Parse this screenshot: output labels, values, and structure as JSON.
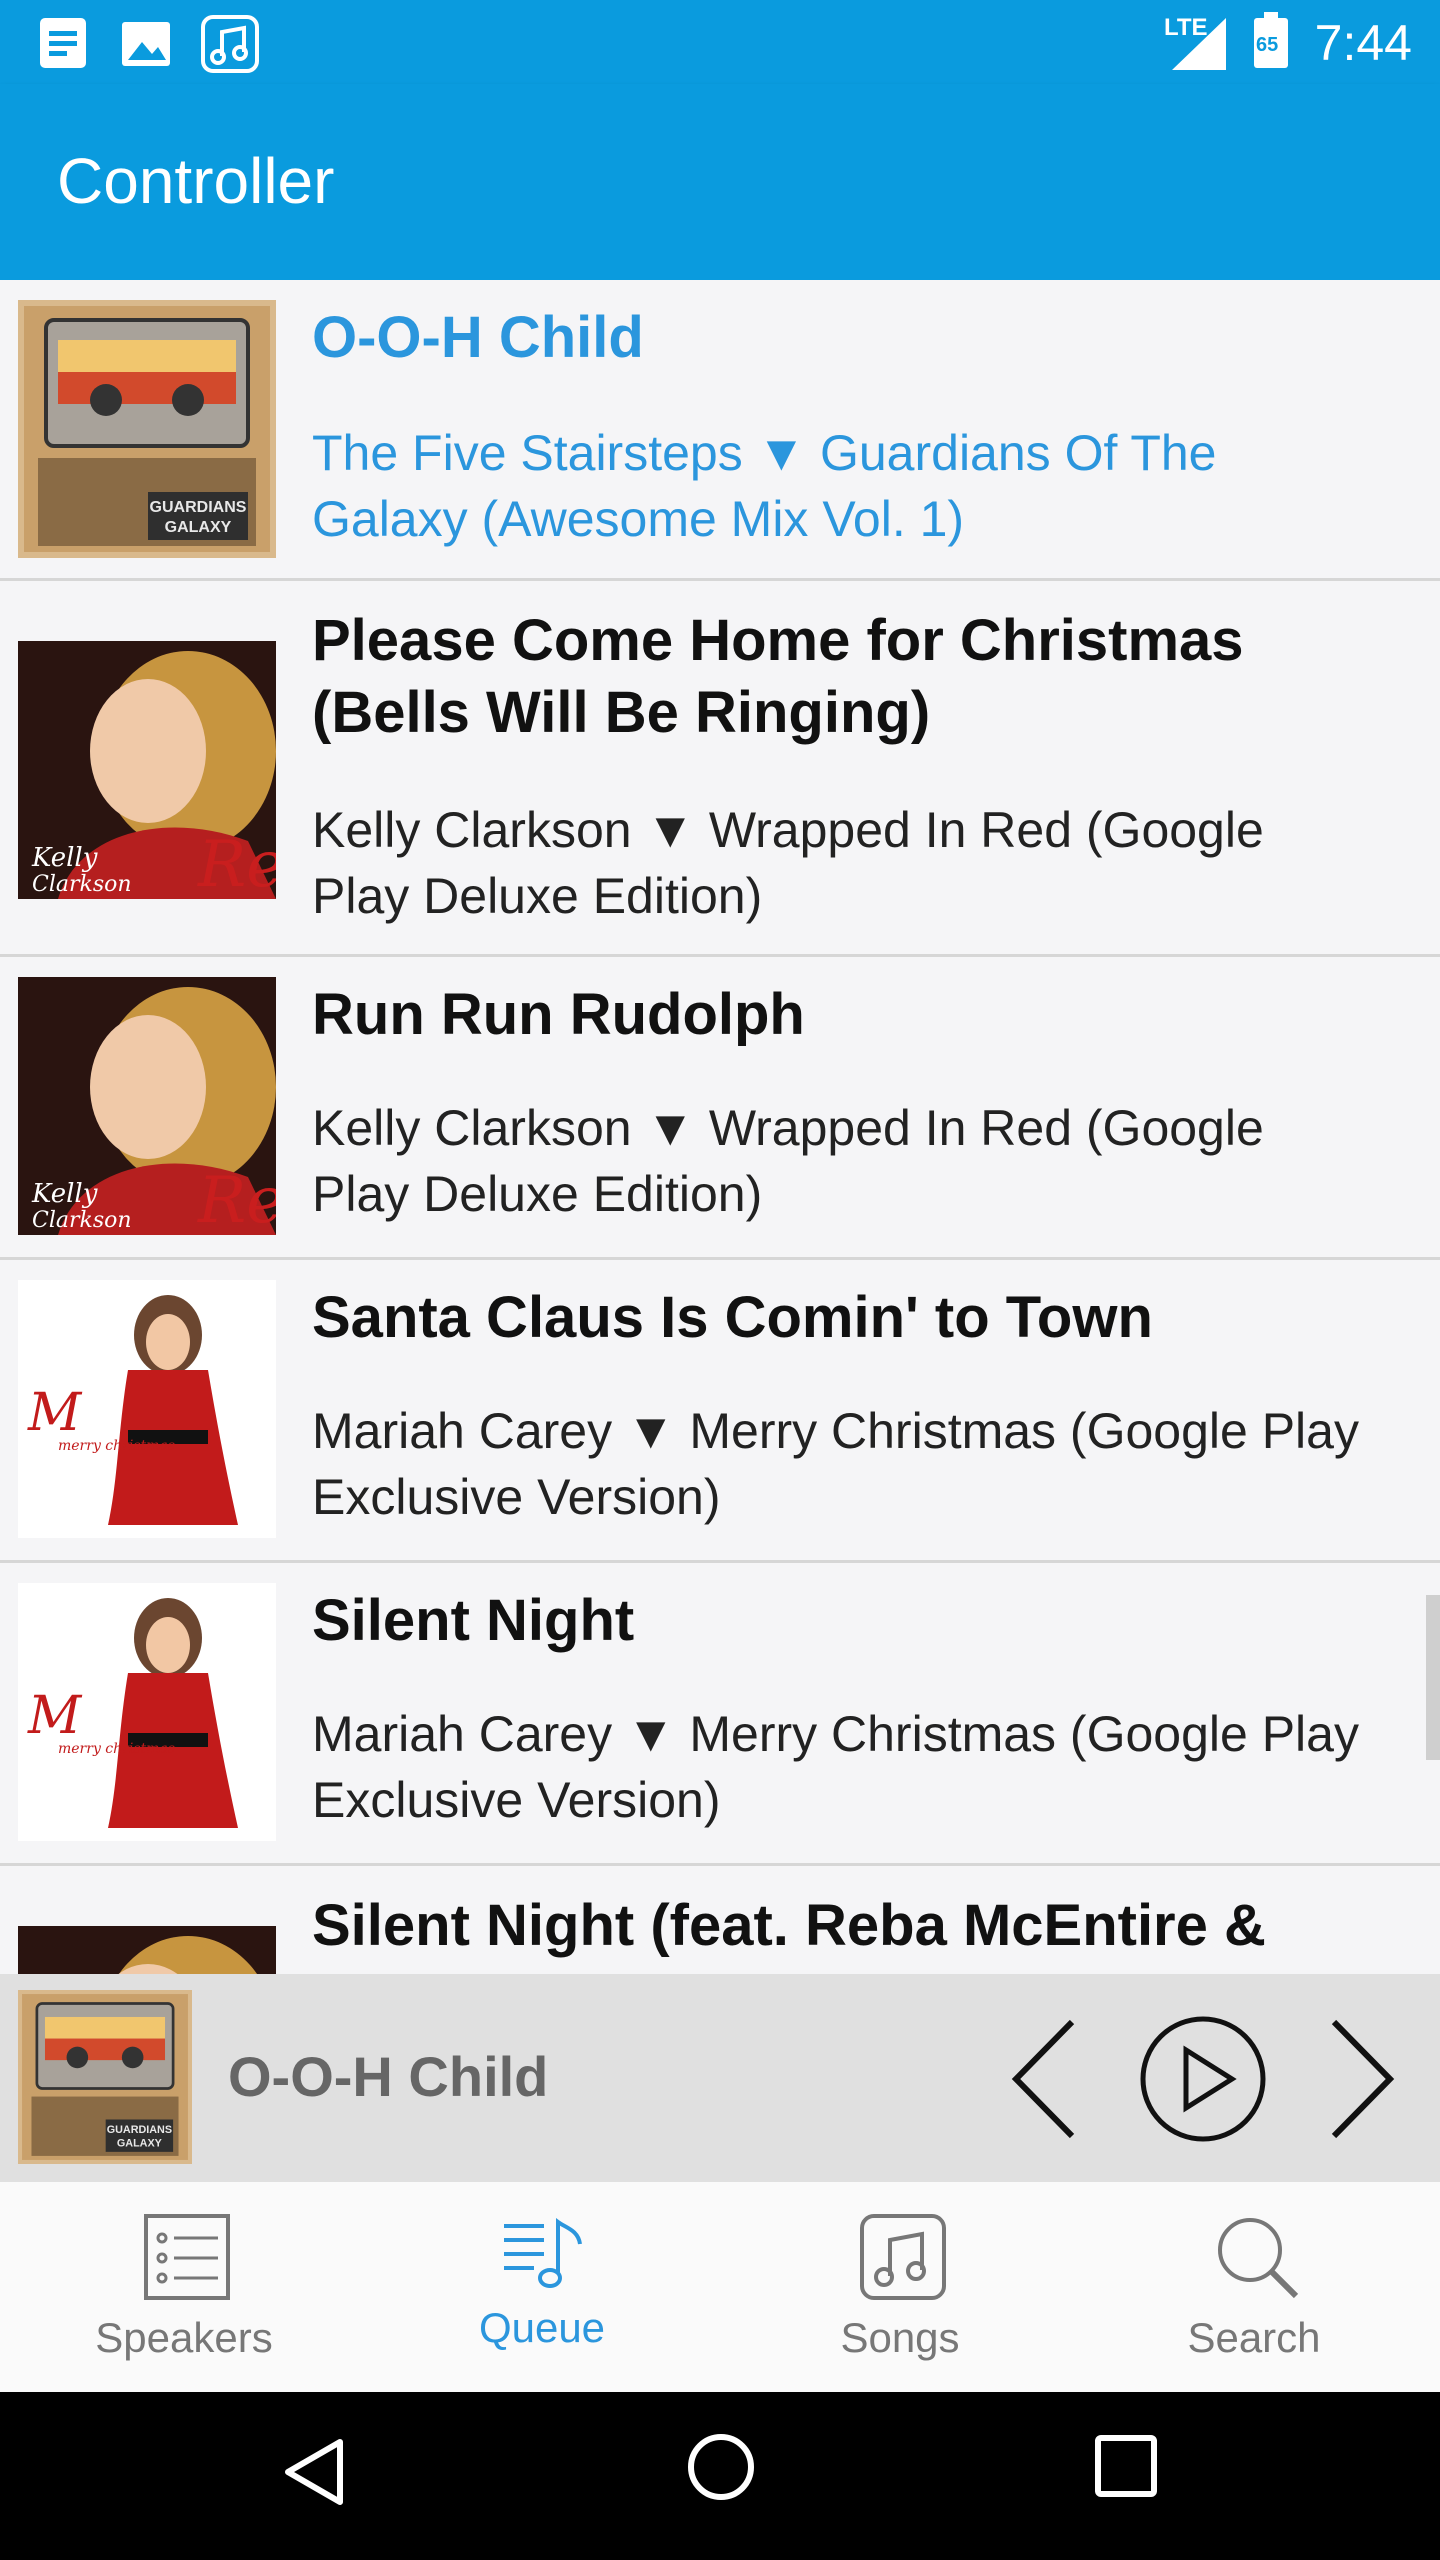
{
  "status_bar": {
    "time": "7:44",
    "network": "LTE",
    "battery": "65",
    "left_icons": [
      "notes-icon",
      "image-icon",
      "music-note-icon"
    ],
    "right_icons": [
      "signal-icon",
      "battery-icon"
    ]
  },
  "app_bar": {
    "title": "Controller"
  },
  "queue": [
    {
      "title": "O-O-H Child",
      "subtitle": "The Five Stairsteps ▼ Guardians Of The Galaxy (Awesome Mix Vol. 1)",
      "art": "album-art-guardians",
      "active": true
    },
    {
      "title": "Please Come Home for Christmas (Bells Will Be Ringing)",
      "subtitle": "Kelly Clarkson ▼ Wrapped In Red (Google Play Deluxe Edition)",
      "art": "album-art-wrapped-in-red",
      "active": false
    },
    {
      "title": "Run Run Rudolph",
      "subtitle": "Kelly Clarkson ▼ Wrapped In Red (Google Play Deluxe Edition)",
      "art": "album-art-wrapped-in-red",
      "active": false
    },
    {
      "title": "Santa Claus Is Comin' to Town",
      "subtitle": "Mariah Carey ▼ Merry Christmas (Google Play Exclusive Version)",
      "art": "album-art-merry-christmas",
      "active": false
    },
    {
      "title": "Silent Night",
      "subtitle": "Mariah Carey ▼ Merry Christmas (Google Play Exclusive Version)",
      "art": "album-art-merry-christmas",
      "active": false
    },
    {
      "title": "Silent Night (feat. Reba McEntire &",
      "subtitle": "",
      "art": "album-art-wrapped-in-red",
      "active": false
    }
  ],
  "now_playing": {
    "title": "O-O-H Child",
    "controls": [
      "previous-icon",
      "play-icon",
      "next-icon"
    ]
  },
  "bottom_nav": {
    "tabs": [
      {
        "label": "Speakers",
        "icon": "list-icon",
        "active": false
      },
      {
        "label": "Queue",
        "icon": "queue-music-icon",
        "active": true
      },
      {
        "label": "Songs",
        "icon": "music-note-icon",
        "active": false
      },
      {
        "label": "Search",
        "icon": "search-icon",
        "active": false
      }
    ]
  },
  "system_nav": [
    "back-icon",
    "home-icon",
    "recents-icon"
  ],
  "colors": {
    "primary": "#0a9bde",
    "accent_text": "#2b96dd",
    "background": "#f5f5f7"
  }
}
